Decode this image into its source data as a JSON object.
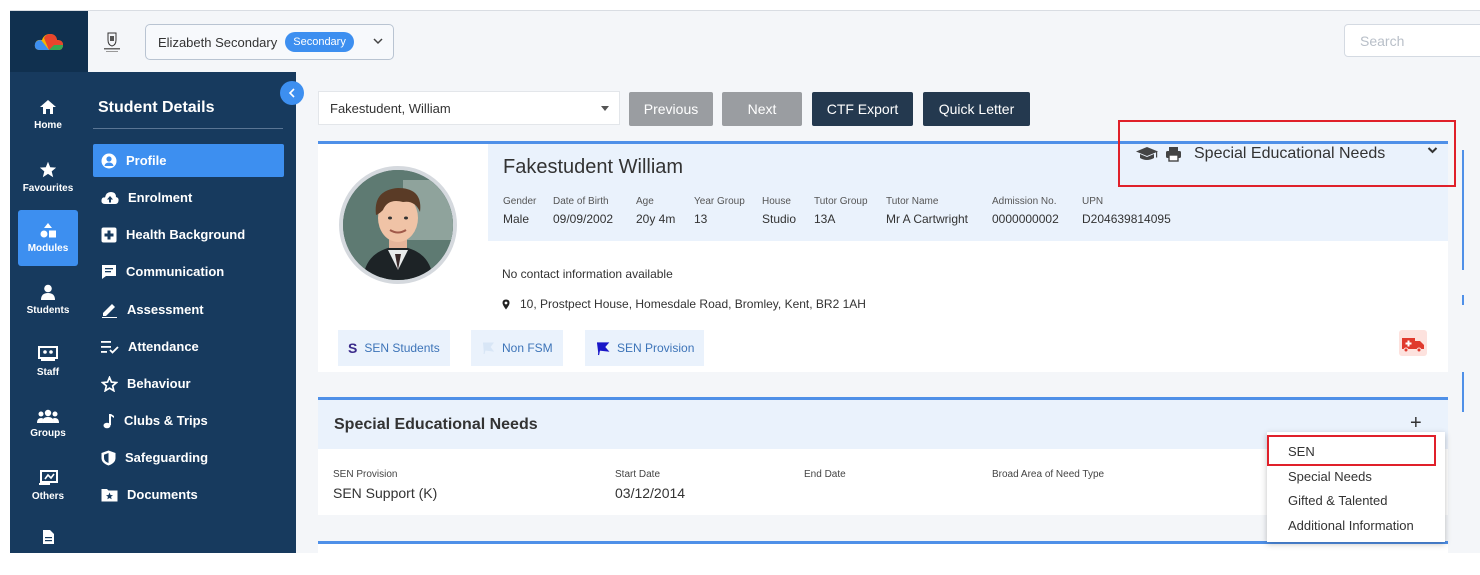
{
  "topbar": {
    "school_name": "Elizabeth Secondary",
    "school_badge": "Secondary",
    "search_placeholder": "Search"
  },
  "rail": {
    "items": [
      {
        "label": "Home",
        "icon": "home-icon"
      },
      {
        "label": "Favourites",
        "icon": "star-icon"
      },
      {
        "label": "Modules",
        "icon": "modules-icon",
        "active": true
      },
      {
        "label": "Students",
        "icon": "user-icon"
      },
      {
        "label": "Staff",
        "icon": "staff-icon"
      },
      {
        "label": "Groups",
        "icon": "groups-icon"
      },
      {
        "label": "Others",
        "icon": "others-icon"
      }
    ]
  },
  "sidebar": {
    "title": "Student Details",
    "items": [
      {
        "label": "Profile",
        "icon": "user-circle-icon",
        "active": true
      },
      {
        "label": "Enrolment",
        "icon": "cloud-upload-icon"
      },
      {
        "label": "Health Background",
        "icon": "plus-square-icon"
      },
      {
        "label": "Communication",
        "icon": "message-icon"
      },
      {
        "label": "Assessment",
        "icon": "pencil-icon"
      },
      {
        "label": "Attendance",
        "icon": "list-check-icon"
      },
      {
        "label": "Behaviour",
        "icon": "star-outline-icon"
      },
      {
        "label": "Clubs & Trips",
        "icon": "music-note-icon"
      },
      {
        "label": "Safeguarding",
        "icon": "shield-icon"
      },
      {
        "label": "Documents",
        "icon": "folder-star-icon"
      }
    ]
  },
  "toolbar": {
    "student_value": "Fakestudent, William",
    "previous": "Previous",
    "next": "Next",
    "ctf_export": "CTF Export",
    "quick_letter": "Quick Letter"
  },
  "profile": {
    "name": "Fakestudent William",
    "details": [
      {
        "label": "Gender",
        "value": "Male"
      },
      {
        "label": "Date of Birth",
        "value": "09/09/2002"
      },
      {
        "label": "Age",
        "value": "20y 4m"
      },
      {
        "label": "Year Group",
        "value": "13"
      },
      {
        "label": "House",
        "value": "Studio"
      },
      {
        "label": "Tutor Group",
        "value": "13A"
      },
      {
        "label": "Tutor Name",
        "value": "Mr A Cartwright"
      },
      {
        "label": "Admission No.",
        "value": "0000000002"
      },
      {
        "label": "UPN",
        "value": "D204639814095"
      }
    ],
    "contact": "No contact information available",
    "address": "10, Prostpect House, Homesdale Road, Bromley, Kent, BR2 1AH",
    "tags": [
      {
        "glyph": "S",
        "label": "SEN Students"
      },
      {
        "glyph": "flag",
        "label": "Non FSM"
      },
      {
        "glyph": "flag",
        "label": "SEN Provision"
      }
    ]
  },
  "sen_selector": {
    "label": "Special Educational Needs"
  },
  "sen_panel": {
    "title": "Special Educational Needs",
    "add": "+",
    "fields": [
      {
        "label": "SEN Provision",
        "value": "SEN Support (K)"
      },
      {
        "label": "Start Date",
        "value": "03/12/2014"
      },
      {
        "label": "End Date",
        "value": ""
      },
      {
        "label": "Broad Area of Need Type",
        "value": ""
      }
    ]
  },
  "sen_menu": {
    "items": [
      "SEN",
      "Special Needs",
      "Gifted & Talented",
      "Additional Information"
    ]
  },
  "colors": {
    "navy": "#173a5e",
    "accent": "#3d8ff0",
    "highlight_red": "#e0202a"
  }
}
